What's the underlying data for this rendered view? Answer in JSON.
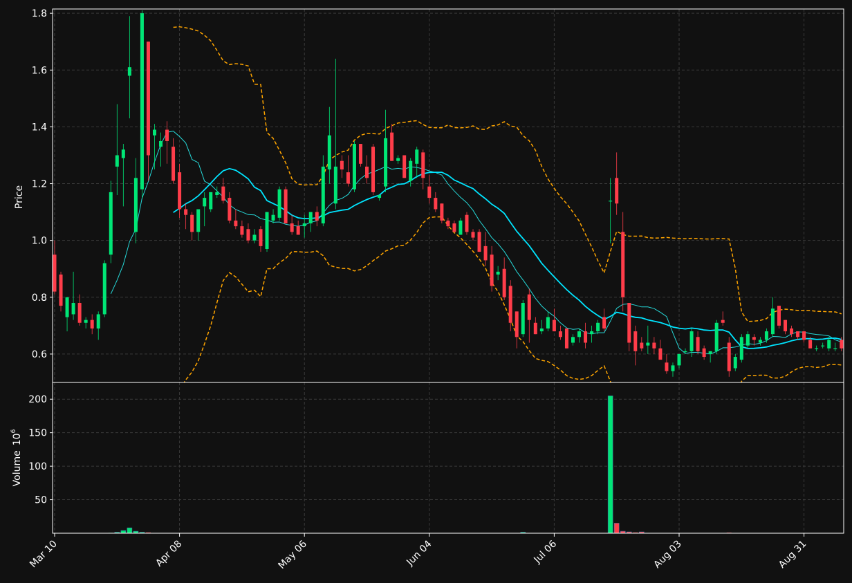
{
  "chart_data": {
    "type": "candlestick",
    "ylabel": "Price",
    "ylim": [
      0.5,
      1.815
    ],
    "y_ticks": [
      "0.6",
      "0.8",
      "1.0",
      "1.2",
      "1.4",
      "1.6",
      "1.8"
    ],
    "volume_ylabel": "Volume",
    "volume_exponent": "10",
    "volume_exponent_power": "6",
    "volume_ylim": [
      0,
      225
    ],
    "volume_ticks": [
      "50",
      "100",
      "150",
      "200"
    ],
    "x_tick_labels": [
      {
        "label": "Mar 10",
        "index": 0
      },
      {
        "label": "Apr 08",
        "index": 20
      },
      {
        "label": "May 06",
        "index": 40
      },
      {
        "label": "Jun 04",
        "index": 60
      },
      {
        "label": "Jul 06",
        "index": 80
      },
      {
        "label": "Aug 03",
        "index": 100
      },
      {
        "label": "Aug 31",
        "index": 120
      }
    ],
    "colors": {
      "up": "#00e676",
      "down": "#ff3d4a",
      "ma_short": "#26d9d9",
      "ma_long": "#00e5ff",
      "bands": "#ffa500",
      "grid": "#3a3a3a",
      "background": "#111111",
      "axis": "#ffffff"
    },
    "ohlc": [
      [
        0.95,
        1.0,
        0.81,
        0.82
      ],
      [
        0.88,
        0.89,
        0.75,
        0.77
      ],
      [
        0.73,
        0.8,
        0.68,
        0.8
      ],
      [
        0.74,
        0.89,
        0.72,
        0.78
      ],
      [
        0.78,
        0.81,
        0.7,
        0.71
      ],
      [
        0.71,
        0.73,
        0.69,
        0.72
      ],
      [
        0.72,
        0.74,
        0.67,
        0.69
      ],
      [
        0.69,
        0.75,
        0.65,
        0.74
      ],
      [
        0.74,
        0.93,
        0.73,
        0.92
      ],
      [
        0.95,
        1.21,
        0.92,
        1.17
      ],
      [
        1.26,
        1.48,
        1.16,
        1.3
      ],
      [
        1.29,
        1.34,
        1.12,
        1.32
      ],
      [
        1.58,
        1.79,
        1.43,
        1.61
      ],
      [
        1.03,
        1.29,
        0.99,
        1.22
      ],
      [
        1.18,
        1.81,
        1.15,
        1.8
      ],
      [
        1.7,
        1.7,
        1.21,
        1.3
      ],
      [
        1.37,
        1.41,
        1.25,
        1.39
      ],
      [
        1.33,
        1.38,
        1.26,
        1.35
      ],
      [
        1.39,
        1.42,
        1.27,
        1.35
      ],
      [
        1.33,
        1.36,
        1.2,
        1.21
      ],
      [
        1.24,
        1.27,
        1.08,
        1.11
      ],
      [
        1.11,
        1.13,
        1.04,
        1.09
      ],
      [
        1.09,
        1.1,
        1.0,
        1.03
      ],
      [
        1.03,
        1.11,
        1.0,
        1.11
      ],
      [
        1.12,
        1.17,
        1.05,
        1.15
      ],
      [
        1.11,
        1.17,
        1.1,
        1.17
      ],
      [
        1.16,
        1.19,
        1.15,
        1.17
      ],
      [
        1.19,
        1.22,
        1.13,
        1.14
      ],
      [
        1.15,
        1.17,
        1.06,
        1.07
      ],
      [
        1.07,
        1.11,
        1.04,
        1.05
      ],
      [
        1.05,
        1.07,
        1.01,
        1.02
      ],
      [
        1.04,
        1.06,
        0.99,
        1.0
      ],
      [
        1.0,
        1.04,
        0.99,
        1.02
      ],
      [
        1.04,
        1.05,
        0.96,
        0.98
      ],
      [
        0.97,
        1.1,
        0.96,
        1.1
      ],
      [
        1.07,
        1.11,
        1.06,
        1.09
      ],
      [
        1.08,
        1.19,
        1.07,
        1.18
      ],
      [
        1.18,
        1.19,
        1.06,
        1.06
      ],
      [
        1.06,
        1.09,
        1.02,
        1.03
      ],
      [
        1.05,
        1.07,
        1.02,
        1.02
      ],
      [
        1.05,
        1.09,
        1.01,
        1.06
      ],
      [
        1.06,
        1.1,
        1.03,
        1.1
      ],
      [
        1.1,
        1.12,
        1.05,
        1.07
      ],
      [
        1.06,
        1.3,
        1.05,
        1.26
      ],
      [
        1.25,
        1.47,
        1.2,
        1.37
      ],
      [
        1.13,
        1.64,
        1.11,
        1.26
      ],
      [
        1.28,
        1.3,
        1.22,
        1.25
      ],
      [
        1.24,
        1.3,
        1.19,
        1.2
      ],
      [
        1.18,
        1.35,
        1.17,
        1.34
      ],
      [
        1.34,
        1.34,
        1.26,
        1.27
      ],
      [
        1.26,
        1.3,
        1.2,
        1.22
      ],
      [
        1.33,
        1.34,
        1.16,
        1.17
      ],
      [
        1.15,
        1.16,
        1.14,
        1.16
      ],
      [
        1.19,
        1.46,
        1.17,
        1.36
      ],
      [
        1.38,
        1.41,
        1.28,
        1.28
      ],
      [
        1.28,
        1.3,
        1.27,
        1.29
      ],
      [
        1.3,
        1.3,
        1.22,
        1.22
      ],
      [
        1.21,
        1.29,
        1.19,
        1.28
      ],
      [
        1.27,
        1.33,
        1.22,
        1.32
      ],
      [
        1.31,
        1.32,
        1.18,
        1.22
      ],
      [
        1.19,
        1.23,
        1.13,
        1.15
      ],
      [
        1.15,
        1.17,
        1.1,
        1.11
      ],
      [
        1.13,
        1.13,
        1.06,
        1.07
      ],
      [
        1.07,
        1.08,
        1.04,
        1.05
      ],
      [
        1.06,
        1.07,
        1.03,
        1.03
      ],
      [
        1.02,
        1.08,
        1.02,
        1.07
      ],
      [
        1.09,
        1.1,
        1.02,
        1.03
      ],
      [
        1.03,
        1.04,
        1.0,
        1.01
      ],
      [
        1.03,
        1.04,
        0.96,
        0.96
      ],
      [
        0.98,
        1.03,
        0.91,
        0.93
      ],
      [
        0.95,
        0.98,
        0.82,
        0.84
      ],
      [
        0.88,
        0.91,
        0.86,
        0.89
      ],
      [
        0.9,
        0.94,
        0.79,
        0.8
      ],
      [
        0.84,
        0.86,
        0.68,
        0.71
      ],
      [
        0.75,
        0.75,
        0.62,
        0.66
      ],
      [
        0.67,
        0.79,
        0.66,
        0.78
      ],
      [
        0.81,
        0.83,
        0.64,
        0.72
      ],
      [
        0.71,
        0.73,
        0.67,
        0.67
      ],
      [
        0.68,
        0.72,
        0.67,
        0.69
      ],
      [
        0.69,
        0.75,
        0.68,
        0.73
      ],
      [
        0.72,
        0.76,
        0.68,
        0.68
      ],
      [
        0.68,
        0.7,
        0.65,
        0.66
      ],
      [
        0.69,
        0.69,
        0.62,
        0.62
      ],
      [
        0.64,
        0.67,
        0.63,
        0.66
      ],
      [
        0.66,
        0.69,
        0.64,
        0.68
      ],
      [
        0.68,
        0.71,
        0.62,
        0.64
      ],
      [
        0.67,
        0.7,
        0.64,
        0.68
      ],
      [
        0.68,
        0.72,
        0.67,
        0.71
      ],
      [
        0.73,
        0.76,
        0.68,
        0.69
      ],
      [
        1.14,
        1.22,
        0.99,
        1.14
      ],
      [
        1.22,
        1.31,
        1.09,
        1.13
      ],
      [
        1.03,
        1.1,
        0.75,
        0.8
      ],
      [
        0.78,
        0.78,
        0.61,
        0.64
      ],
      [
        0.68,
        0.7,
        0.56,
        0.61
      ],
      [
        0.64,
        0.66,
        0.61,
        0.62
      ],
      [
        0.63,
        0.7,
        0.6,
        0.64
      ],
      [
        0.64,
        0.66,
        0.6,
        0.62
      ],
      [
        0.62,
        0.65,
        0.59,
        0.58
      ],
      [
        0.57,
        0.6,
        0.53,
        0.54
      ],
      [
        0.54,
        0.57,
        0.52,
        0.56
      ],
      [
        0.56,
        0.6,
        0.55,
        0.6
      ],
      [
        0.61,
        0.62,
        0.6,
        0.61
      ],
      [
        0.61,
        0.69,
        0.59,
        0.68
      ],
      [
        0.66,
        0.68,
        0.6,
        0.61
      ],
      [
        0.62,
        0.63,
        0.58,
        0.59
      ],
      [
        0.6,
        0.61,
        0.57,
        0.61
      ],
      [
        0.61,
        0.72,
        0.6,
        0.71
      ],
      [
        0.72,
        0.75,
        0.7,
        0.71
      ],
      [
        0.64,
        0.66,
        0.52,
        0.54
      ],
      [
        0.55,
        0.6,
        0.54,
        0.59
      ],
      [
        0.58,
        0.67,
        0.57,
        0.66
      ],
      [
        0.63,
        0.68,
        0.62,
        0.67
      ],
      [
        0.66,
        0.67,
        0.63,
        0.65
      ],
      [
        0.64,
        0.66,
        0.63,
        0.65
      ],
      [
        0.65,
        0.69,
        0.64,
        0.68
      ],
      [
        0.67,
        0.8,
        0.66,
        0.76
      ],
      [
        0.77,
        0.77,
        0.69,
        0.7
      ],
      [
        0.72,
        0.72,
        0.67,
        0.68
      ],
      [
        0.69,
        0.7,
        0.66,
        0.67
      ],
      [
        0.68,
        0.68,
        0.65,
        0.66
      ],
      [
        0.68,
        0.68,
        0.64,
        0.65
      ],
      [
        0.65,
        0.66,
        0.62,
        0.62
      ],
      [
        0.62,
        0.63,
        0.61,
        0.62
      ],
      [
        0.63,
        0.64,
        0.62,
        0.63
      ],
      [
        0.62,
        0.66,
        0.61,
        0.65
      ],
      [
        0.62,
        0.64,
        0.61,
        0.62
      ],
      [
        0.65,
        0.66,
        0.61,
        0.62
      ]
    ],
    "volume": [
      0.3,
      0.3,
      0.3,
      0.3,
      0.3,
      0.3,
      0.3,
      0.3,
      0.3,
      0.6,
      1.5,
      4,
      8,
      3,
      1.5,
      1,
      0.5,
      0.3,
      0.3,
      0.3,
      0.3,
      0.3,
      0.3,
      0.3,
      0.3,
      0.3,
      0.3,
      0.3,
      0.3,
      0.3,
      0.3,
      0.3,
      0.3,
      0.3,
      0.3,
      0.3,
      0.3,
      0.3,
      0.3,
      0.3,
      0.3,
      0.3,
      0.3,
      0.3,
      0.3,
      0.3,
      0.3,
      0.3,
      0.3,
      0.3,
      0.3,
      0.3,
      0.3,
      0.3,
      0.3,
      0.3,
      0.3,
      0.3,
      0.3,
      0.3,
      0.3,
      0.3,
      0.3,
      0.3,
      0.3,
      0.3,
      0.3,
      0.3,
      0.3,
      0.3,
      0.3,
      0.3,
      0.3,
      0.3,
      0.5,
      1.5,
      0.5,
      0.3,
      0.3,
      0.3,
      0.3,
      0.3,
      0.3,
      0.3,
      0.3,
      0.3,
      0.3,
      0.3,
      0.3,
      205,
      15,
      3,
      2,
      1,
      2,
      0.5,
      0.3,
      0.3,
      0.3,
      0.3,
      0.3,
      0.3,
      0.3,
      0.3,
      0.3,
      0.3,
      0.3,
      0.3,
      0.8,
      0.5,
      0.3,
      0.3,
      0.3,
      0.3,
      0.3,
      0.3,
      0.3,
      0.3,
      0.3,
      0.3,
      0.3,
      0.3,
      0.3,
      0.3,
      0.3,
      0.3,
      0.3
    ],
    "ma_short_period": 10,
    "ma_long_period": 20,
    "band_std": 2
  }
}
